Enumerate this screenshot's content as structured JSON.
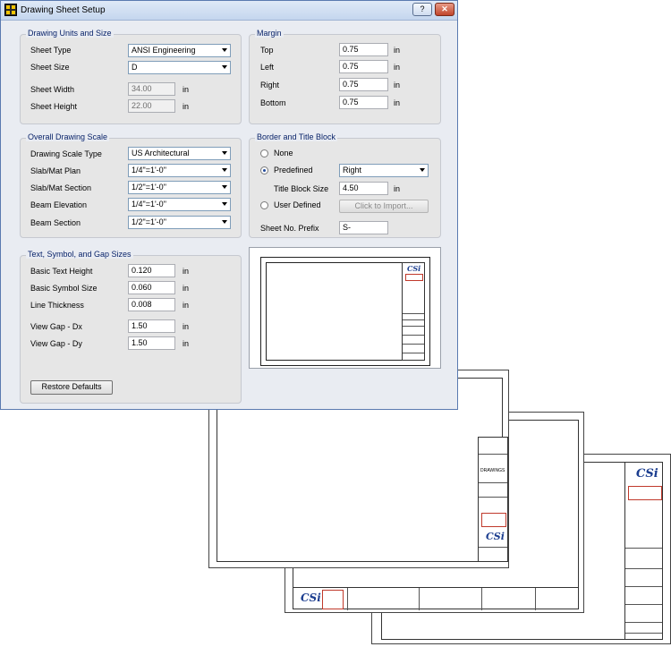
{
  "window": {
    "title": "Drawing Sheet Setup",
    "help_label": "?",
    "close_label": "✕"
  },
  "units_size": {
    "title": "Drawing Units and Size",
    "sheet_type_label": "Sheet Type",
    "sheet_type": "ANSI Engineering",
    "sheet_size_label": "Sheet Size",
    "sheet_size": "D",
    "sheet_width_label": "Sheet Width",
    "sheet_width": "34.00",
    "sheet_height_label": "Sheet Height",
    "sheet_height": "22.00",
    "unit": "in"
  },
  "margin": {
    "title": "Margin",
    "top_label": "Top",
    "top": "0.75",
    "left_label": "Left",
    "left": "0.75",
    "right_label": "Right",
    "right": "0.75",
    "bottom_label": "Bottom",
    "bottom": "0.75",
    "unit": "in"
  },
  "scale": {
    "title": "Overall Drawing Scale",
    "type_label": "Drawing Scale Type",
    "type": "US Architectural",
    "slab_plan_label": "Slab/Mat Plan",
    "slab_plan": "1/4\"=1'-0\"",
    "slab_section_label": "Slab/Mat Section",
    "slab_section": "1/2\"=1'-0\"",
    "beam_elev_label": "Beam Elevation",
    "beam_elev": "1/4\"=1'-0\"",
    "beam_section_label": "Beam Section",
    "beam_section": "1/2\"=1'-0\""
  },
  "border": {
    "title": "Border and Title Block",
    "none_label": "None",
    "predefined_label": "Predefined",
    "predefined_value": "Right",
    "title_block_size_label": "Title Block Size",
    "title_block_size": "4.50",
    "unit": "in",
    "user_defined_label": "User Defined",
    "import_label": "Click to Import...",
    "prefix_label": "Sheet No. Prefix",
    "prefix": "S-",
    "selected": "predefined"
  },
  "text_sizes": {
    "title": "Text, Symbol, and Gap Sizes",
    "text_height_label": "Basic Text Height",
    "text_height": "0.120",
    "symbol_size_label": "Basic Symbol Size",
    "symbol_size": "0.060",
    "line_thickness_label": "Line Thickness",
    "line_thickness": "0.008",
    "gap_dx_label": "View Gap - Dx",
    "gap_dx": "1.50",
    "gap_dy_label": "View Gap - Dy",
    "gap_dy": "1.50",
    "unit": "in"
  },
  "restore_label": "Restore Defaults",
  "sheets": {
    "logo_text": "CSi",
    "drawings_label": "DRAWINGS"
  },
  "colors": {
    "accent": "#0a246a",
    "logo": "#1b3d8f",
    "stamp": "#c0392b"
  }
}
